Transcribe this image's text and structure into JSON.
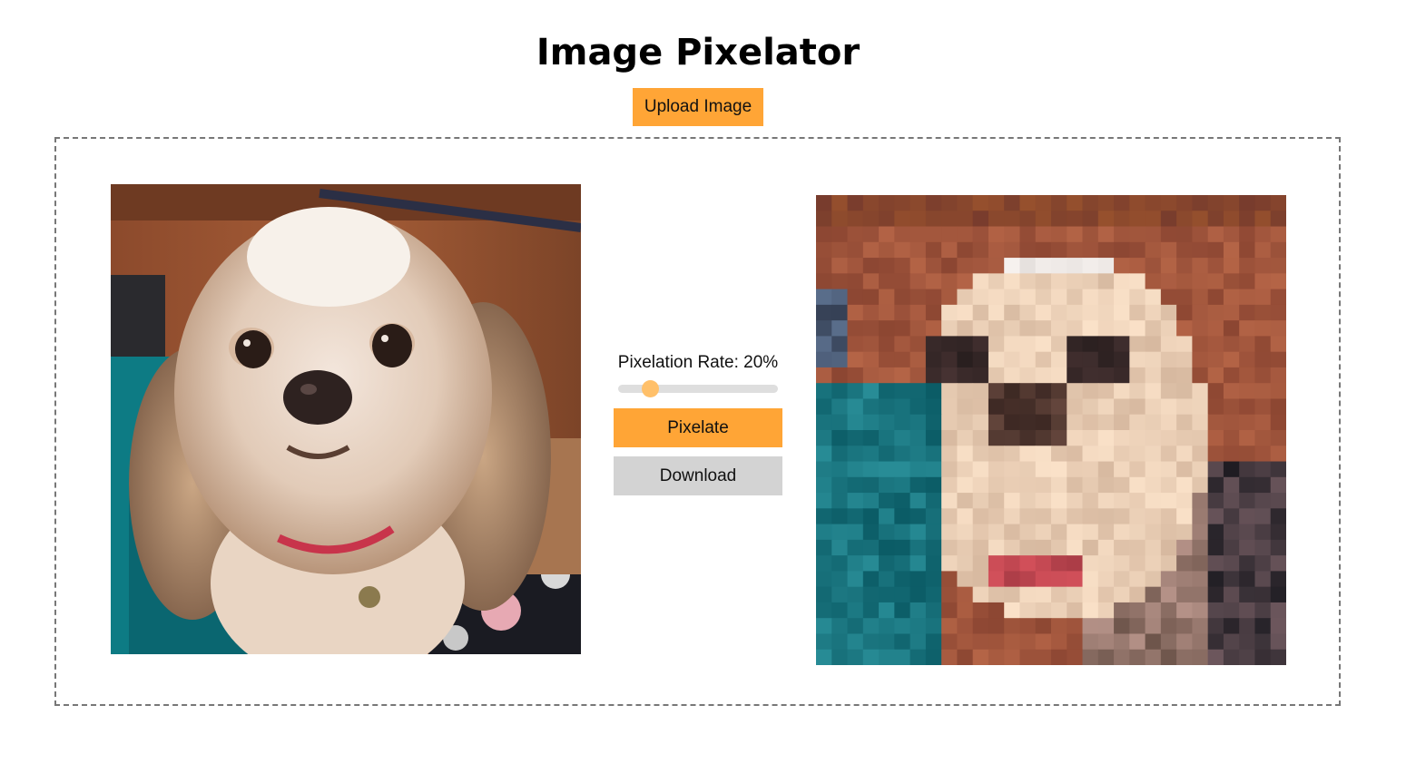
{
  "app": {
    "title": "Image Pixelator",
    "upload_label": "Upload Image"
  },
  "controls": {
    "rate_label": "Pixelation Rate: 20%",
    "rate_value": 20,
    "rate_min": 0,
    "rate_max": 100,
    "pixelate_label": "Pixelate",
    "download_label": "Download"
  },
  "images": {
    "original_alt": "dog-photo",
    "pixelated_alt": "pixelated-dog-photo"
  },
  "colors": {
    "accent": "#ffa536",
    "secondary_button": "#d3d3d3",
    "slider_thumb": "#ffc06a",
    "slider_track": "#dedede",
    "border": "#777777"
  }
}
